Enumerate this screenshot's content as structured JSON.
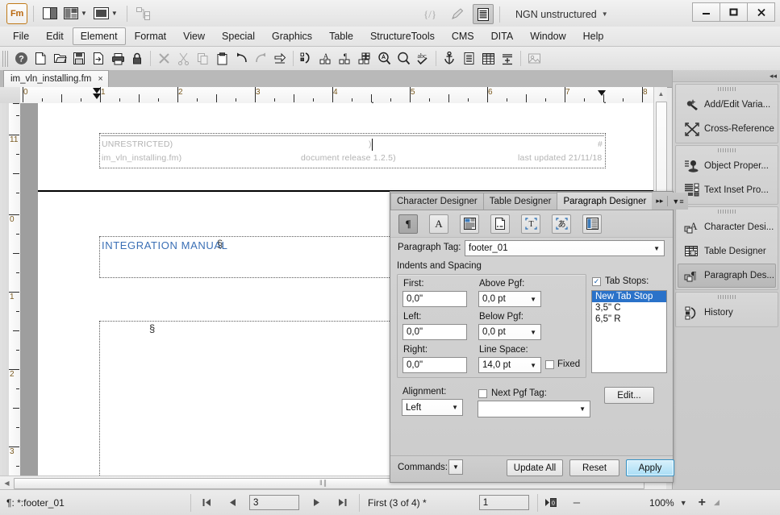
{
  "titlebar": {
    "app_logo": "Fm",
    "workspace": "NGN unstructured",
    "minimize": "–",
    "maximize": "□",
    "close": "✕"
  },
  "menubar": {
    "items": [
      {
        "label": "File",
        "active": false
      },
      {
        "label": "Edit",
        "active": false
      },
      {
        "label": "Element",
        "active": true
      },
      {
        "label": "Format",
        "active": false
      },
      {
        "label": "View",
        "active": false
      },
      {
        "label": "Special",
        "active": false
      },
      {
        "label": "Graphics",
        "active": false
      },
      {
        "label": "Table",
        "active": false
      },
      {
        "label": "StructureTools",
        "active": false
      },
      {
        "label": "CMS",
        "active": false
      },
      {
        "label": "DITA",
        "active": false
      },
      {
        "label": "Window",
        "active": false
      },
      {
        "label": "Help",
        "active": false
      }
    ]
  },
  "doc_tab": {
    "filename": "im_vln_installing.fm",
    "close": "×"
  },
  "ruler": {
    "horizontal_labels": [
      "0",
      "1",
      "2",
      "3",
      "4",
      "5",
      "6",
      "7",
      "8"
    ],
    "vertical_labels": [
      "11",
      "0",
      "1",
      "2",
      "3"
    ]
  },
  "document": {
    "footer_frame": {
      "left_top": "UNRESTRICTED)",
      "center_top": ")",
      "right_top": "#",
      "left_bottom": "im_vln_installing.fm)",
      "center_bottom": "document release 1.2.5)",
      "right_bottom": "last updated 21/11/18"
    },
    "body": {
      "heading": "INTEGRATION MANUAL",
      "heading_mark": "§",
      "paragraph_mark": "§"
    }
  },
  "dock": {
    "collapse_icon": "collapse-icon",
    "groups": [
      {
        "items": [
          {
            "label": "Add/Edit Varia...",
            "icon": "variable-icon",
            "selected": false
          },
          {
            "label": "Cross-Reference",
            "icon": "cross-reference-icon",
            "selected": false
          }
        ]
      },
      {
        "items": [
          {
            "label": "Object Proper...",
            "icon": "object-properties-icon",
            "selected": false
          },
          {
            "label": "Text Inset Pro...",
            "icon": "text-inset-icon",
            "selected": false
          }
        ]
      },
      {
        "items": [
          {
            "label": "Character Desi...",
            "icon": "character-designer-icon",
            "selected": false
          },
          {
            "label": "Table Designer",
            "icon": "table-designer-icon",
            "selected": false
          },
          {
            "label": "Paragraph Des...",
            "icon": "paragraph-designer-icon",
            "selected": true
          }
        ]
      },
      {
        "items": [
          {
            "label": "History",
            "icon": "history-icon",
            "selected": false
          }
        ]
      }
    ]
  },
  "paragraph_designer": {
    "tabs": [
      {
        "label": "Character Designer",
        "active": false
      },
      {
        "label": "Table Designer",
        "active": false
      },
      {
        "label": "Paragraph Designer",
        "active": true
      }
    ],
    "header_controls": {
      "expand": "▸▸",
      "menu": "panel-menu-icon"
    },
    "property_icons": [
      {
        "name": "basic-properties-icon",
        "glyph": "¶",
        "active": true
      },
      {
        "name": "default-font-icon",
        "glyph": "A",
        "active": false
      },
      {
        "name": "pagination-icon",
        "glyph": "alignment",
        "active": false
      },
      {
        "name": "numbering-icon",
        "glyph": "page",
        "active": false
      },
      {
        "name": "advanced-icon",
        "glyph": "T",
        "active": false
      },
      {
        "name": "asian-icon",
        "glyph": "あ",
        "active": false
      },
      {
        "name": "table-cell-icon",
        "glyph": "table",
        "active": false
      }
    ],
    "paragraph_tag": {
      "label": "Paragraph Tag:",
      "value": "footer_01"
    },
    "section_title": "Indents and Spacing",
    "indents": [
      {
        "label": "First:",
        "value": "0,0\""
      },
      {
        "label": "Left:",
        "value": "0,0\""
      },
      {
        "label": "Right:",
        "value": "0,0\""
      }
    ],
    "spacing": [
      {
        "label": "Above Pgf:",
        "value": "0,0 pt"
      },
      {
        "label": "Below Pgf:",
        "value": "0,0 pt"
      },
      {
        "label": "Line Space:",
        "value": "14,0 pt"
      }
    ],
    "fixed": {
      "label": "Fixed",
      "checked": false
    },
    "tab_stops": {
      "label": "Tab Stops:",
      "checked": true,
      "items": [
        {
          "text": "New Tab Stop",
          "selected": true
        },
        {
          "text": "3,5\"  C",
          "selected": false
        },
        {
          "text": "6,5\"  R",
          "selected": false
        }
      ],
      "edit_button": "Edit..."
    },
    "alignment": {
      "label": "Alignment:",
      "value": "Left"
    },
    "next_pgf_tag": {
      "label": "Next Pgf Tag:",
      "value": "",
      "checked": false
    },
    "footer": {
      "commands_label": "Commands:",
      "update_all": "Update All",
      "reset": "Reset",
      "apply": "Apply"
    }
  },
  "statusbar": {
    "tag_info": "¶: *:footer_01",
    "first_page": "first-page-icon",
    "prev_page": "prev-page-icon",
    "page_value": "3",
    "next_page": "next-page-icon",
    "last_page": "last-page-icon",
    "page_label": "First (3 of 4) *",
    "zoom_field": "1",
    "zoom_fit_icon": "zoom-fit-icon",
    "zoom_out": "–",
    "zoom_value": "100%",
    "zoom_caret": "▼",
    "zoom_in": "+"
  },
  "colors": {
    "accent_blue": "#3a6fb5",
    "selection_blue": "#2a72c9",
    "logo_orange": "#b8660c",
    "ruler_number": "#7a5a20",
    "footer_gray": "#b2b2b2"
  }
}
